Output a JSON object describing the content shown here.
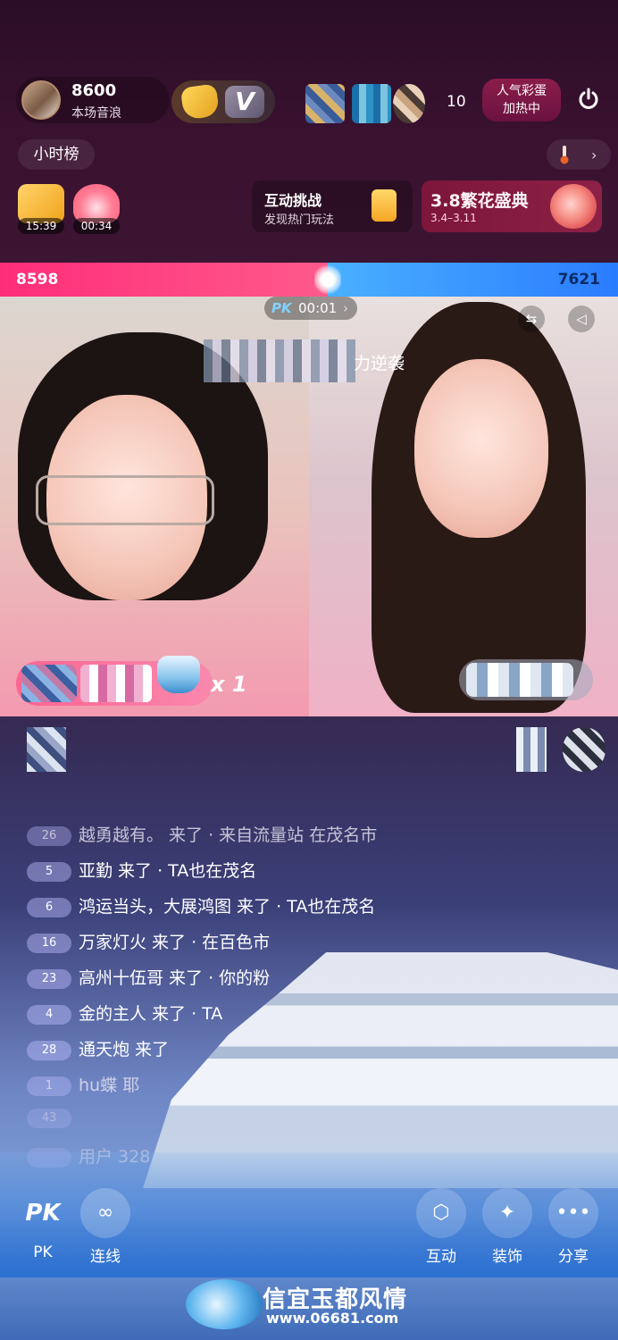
{
  "header": {
    "host_score": "8600",
    "host_score_label": "本场音浪",
    "viewer_count": "10",
    "popularity_line1": "人气彩蛋",
    "popularity_line2": "加热中",
    "rank_label": "小时榜"
  },
  "gifts": [
    {
      "timer": "15:39",
      "icon": "gift-box-icon"
    },
    {
      "timer": "00:34",
      "icon": "flame-icon"
    }
  ],
  "challenge": {
    "title": "互动挑战",
    "subtitle": "发现热门玩法"
  },
  "event": {
    "title": "3.8繁花盛典",
    "date": "3.4–3.11"
  },
  "pk": {
    "left_score": "8598",
    "right_score": "7621",
    "left_share": 0.53,
    "logo": "PK",
    "time": "00:01",
    "banner": "力逆袭",
    "left_gift_count": "x 1"
  },
  "chat": [
    {
      "level": "26",
      "text": "越勇越有。 来了 · 来自流量站 在茂名市"
    },
    {
      "level": "5",
      "text": "亚勤 来了 · TA也在茂名"
    },
    {
      "level": "6",
      "text": "鸿运当头，大展鸿图 来了 · TA也在茂名"
    },
    {
      "level": "16",
      "text": "万家灯火 来了 · 在百色市"
    },
    {
      "level": "23",
      "text": "高州十伍哥 来了 · 你的粉"
    },
    {
      "level": "4",
      "text": "金的主人 来了 · TA"
    },
    {
      "level": "28",
      "text": "通天炮 来了"
    },
    {
      "level": "1",
      "text": "hu蝶 耶"
    },
    {
      "level": "43",
      "text": ""
    },
    {
      "level": "",
      "text": "用户 328"
    }
  ],
  "toolbar": {
    "pk_label": "PK",
    "link_label": "连线",
    "interact_label": "互动",
    "decorate_label": "装饰",
    "share_label": "分享"
  },
  "watermark": {
    "title": "信宜玉都风情",
    "url": "www.06681.com"
  }
}
